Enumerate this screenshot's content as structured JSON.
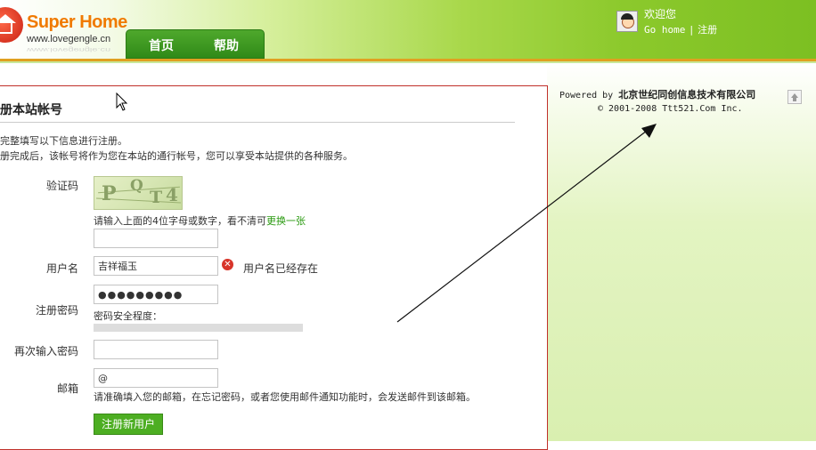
{
  "header": {
    "logo_title": "Super Home",
    "logo_url": "www.lovegengle.cn",
    "nav": [
      {
        "label": "首页"
      },
      {
        "label": "帮助"
      }
    ],
    "welcome": "欢迎您",
    "go_home": "Go home",
    "separator": "|",
    "register_link": "注册"
  },
  "sidebar": {
    "powered_prefix": "Powered by",
    "company": "北京世纪同创信息技术有限公司",
    "copyright": "© 2001-2008 Ttt521.Com Inc."
  },
  "form": {
    "title": "册本站帐号",
    "intro_1": "完整填写以下信息进行注册。",
    "intro_2": "册完成后，该帐号将作为您在本站的通行帐号，您可以享受本站提供的各种服务。",
    "captcha": {
      "label": "验证码",
      "image_chars": [
        "P",
        "Q",
        "T",
        "4"
      ],
      "hint": "请输入上面的4位字母或数字，看不清可",
      "refresh_link": "更换一张",
      "value": ""
    },
    "username": {
      "label": "用户名",
      "value": "吉祥福玉",
      "error": "用户名已经存在"
    },
    "password": {
      "label": "注册密码",
      "value": "●●●●●●●●●",
      "strength_label": "密码安全程度：",
      "strength": 0
    },
    "confirm": {
      "label": "再次输入密码",
      "value": ""
    },
    "email": {
      "label": "邮箱",
      "value": "@",
      "hint": "请准确填入您的邮箱，在忘记密码，或者您使用邮件通知功能时，会发送邮件到该邮箱。"
    },
    "submit_label": "注册新用户"
  },
  "colors": {
    "accent_green": "#4dae22",
    "header_green": "#7cbf22",
    "border_red": "#c0302a",
    "link_green": "#2a9a10"
  }
}
